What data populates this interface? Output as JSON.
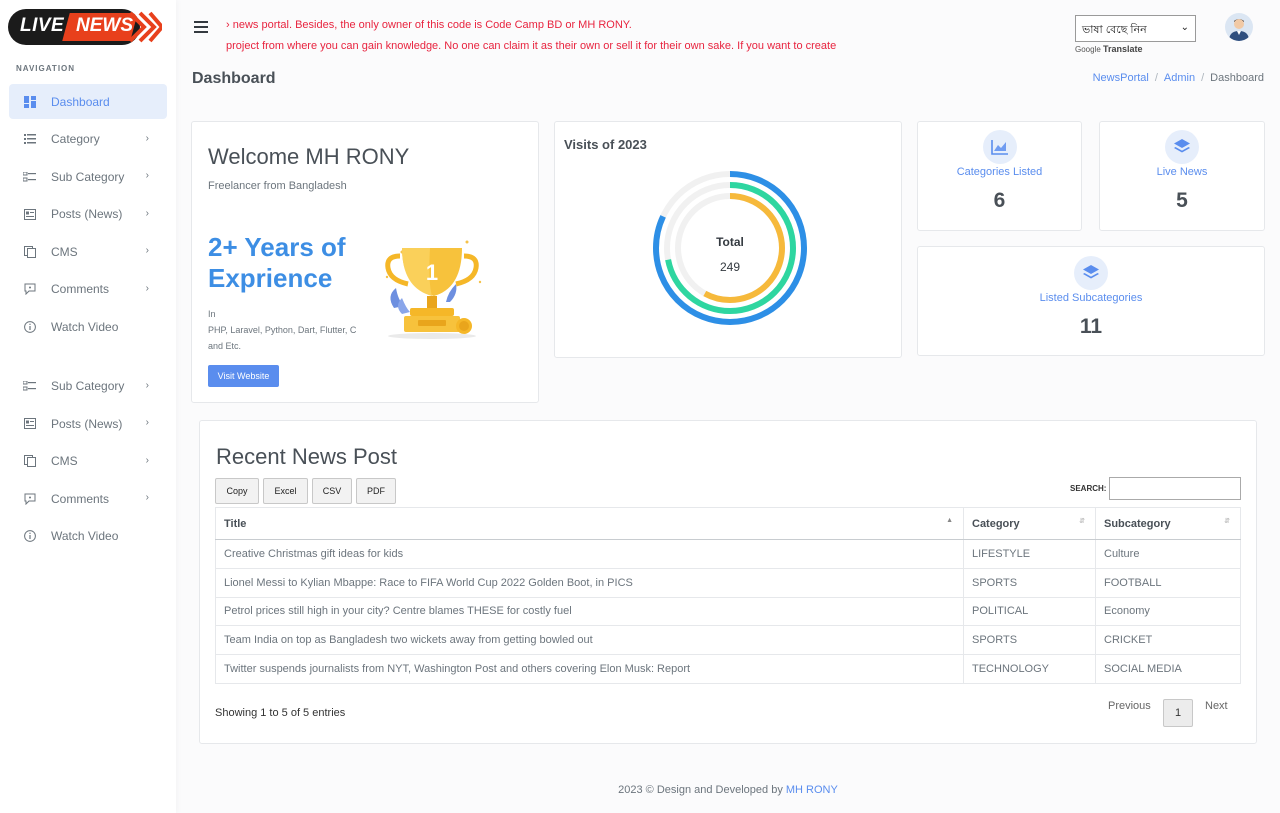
{
  "brand": {
    "live": "LIVE",
    "news": "NEWS"
  },
  "nav": {
    "heading": "NAVIGATION",
    "items": [
      {
        "label": "Dashboard",
        "icon": "dashboard-icon",
        "active": true,
        "chevron": false
      },
      {
        "label": "Category",
        "icon": "list-icon",
        "chevron": true
      },
      {
        "label": "Sub Category",
        "icon": "sublist-icon",
        "chevron": true
      },
      {
        "label": "Posts (News)",
        "icon": "posts-icon",
        "chevron": true
      },
      {
        "label": "CMS",
        "icon": "pages-icon",
        "chevron": true
      },
      {
        "label": "Comments",
        "icon": "comment-icon",
        "chevron": true
      },
      {
        "label": "Watch Video",
        "icon": "info-icon",
        "chevron": false
      }
    ],
    "items2": [
      {
        "label": "Sub Category",
        "icon": "sublist-icon",
        "chevron": true
      },
      {
        "label": "Posts (News)",
        "icon": "posts-icon",
        "chevron": true
      },
      {
        "label": "CMS",
        "icon": "pages-icon",
        "chevron": true
      },
      {
        "label": "Comments",
        "icon": "comment-icon",
        "chevron": true
      },
      {
        "label": "Watch Video",
        "icon": "info-icon",
        "chevron": false
      }
    ]
  },
  "topbar": {
    "marquee_line1": "› news portal. Besides, the only owner of this code is Code Camp BD or MH RONY.",
    "marquee_line2": "project from where you can gain knowledge. No one can claim it as their own or sell it for their own sake. If you want to create",
    "language_select": "ভাষা বেছে নিন",
    "google_label": "Google",
    "translate_label": "Translate"
  },
  "page": {
    "title": "Dashboard",
    "breadcrumb": [
      "NewsPortal",
      "Admin",
      "Dashboard"
    ]
  },
  "welcome": {
    "title": "Welcome MH RONY",
    "subtitle": "Freelancer from Bangladesh",
    "years": "2+ Years of Exprience",
    "in_label": "In",
    "skills": "PHP, Laravel, Python, Dart, Flutter, C and Etc.",
    "button": "Visit Website"
  },
  "visits": {
    "title": "Visits of 2023",
    "total_label": "Total",
    "total_value": "249",
    "ring_fractions": [
      0.58,
      0.72,
      0.82
    ],
    "ring_colors": [
      "#f6b93b",
      "#2ed6a0",
      "#2d8fe6"
    ]
  },
  "stats": {
    "categories": {
      "label": "Categories Listed",
      "value": "6"
    },
    "live_news": {
      "label": "Live News",
      "value": "5"
    },
    "subcategories": {
      "label": "Listed Subcategories",
      "value": "11"
    }
  },
  "recent": {
    "title": "Recent News Post",
    "buttons": [
      "Copy",
      "Excel",
      "CSV",
      "PDF"
    ],
    "search_label": "SEARCH:",
    "columns": [
      "Title",
      "Category",
      "Subcategory"
    ],
    "rows": [
      [
        "Creative Christmas gift ideas for kids",
        "LIFESTYLE",
        "Culture"
      ],
      [
        "Lionel Messi to Kylian Mbappe: Race to FIFA World Cup 2022 Golden Boot, in PICS",
        "SPORTS",
        "FOOTBALL"
      ],
      [
        "Petrol prices still high in your city? Centre blames THESE for costly fuel",
        "POLITICAL",
        "Economy"
      ],
      [
        "Team India on top as Bangladesh two wickets away from getting bowled out",
        "SPORTS",
        "CRICKET"
      ],
      [
        "Twitter suspends journalists from NYT, Washington Post and others covering Elon Musk: Report",
        "TECHNOLOGY",
        "SOCIAL MEDIA"
      ]
    ],
    "info": "Showing 1 to 5 of 5 entries",
    "previous": "Previous",
    "page": "1",
    "next": "Next"
  },
  "footer": {
    "text": "2023 © Design and Developed by",
    "author": "MH RONY"
  },
  "colors": {
    "accent": "#5a8dee",
    "marquee": "#e8243f",
    "heading_blue": "#3d8ee4"
  }
}
